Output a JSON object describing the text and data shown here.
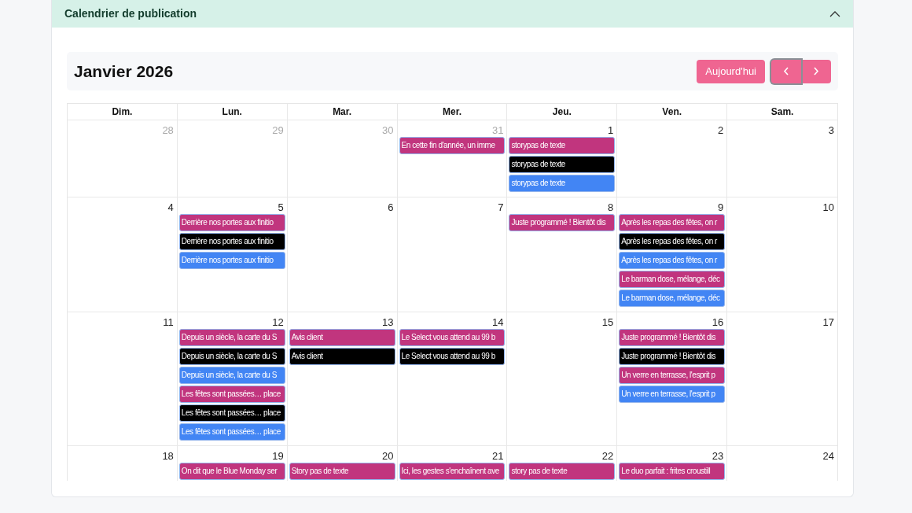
{
  "panel": {
    "title": "Calendrier de publication",
    "expanded": true
  },
  "toolbar": {
    "title": "Janvier 2026",
    "today_button": "Aujourd'hui"
  },
  "weekdays": [
    "Dim.",
    "Lun.",
    "Mar.",
    "Mer.",
    "Jeu.",
    "Ven.",
    "Sam."
  ],
  "weeks": [
    {
      "days": [
        {
          "number": "28",
          "other_month": true
        },
        {
          "number": "29",
          "other_month": true
        },
        {
          "number": "30",
          "other_month": true
        },
        {
          "number": "31",
          "other_month": true,
          "events": [
            {
              "title": "En cette fin d'année, un imme",
              "color": "#c1357e"
            }
          ]
        },
        {
          "number": "1",
          "other_month": false,
          "events": [
            {
              "title": "storypas de texte",
              "color": "#c1357e"
            },
            {
              "title": "storypas de texte",
              "color": "#000000"
            },
            {
              "title": "storypas de texte",
              "color": "#4285f4"
            }
          ]
        },
        {
          "number": "2",
          "other_month": false
        },
        {
          "number": "3",
          "other_month": false
        }
      ]
    },
    {
      "days": [
        {
          "number": "4",
          "other_month": false
        },
        {
          "number": "5",
          "other_month": false,
          "events": [
            {
              "title": "Derrière nos portes aux finitio",
              "color": "#c1357e"
            },
            {
              "title": "Derrière nos portes aux finitio",
              "color": "#000000"
            },
            {
              "title": "Derrière nos portes aux finitio",
              "color": "#4285f4"
            }
          ]
        },
        {
          "number": "6",
          "other_month": false
        },
        {
          "number": "7",
          "other_month": false
        },
        {
          "number": "8",
          "other_month": false,
          "events": [
            {
              "title": "Juste programmé ! Bientôt dis",
              "color": "#c1357e"
            }
          ]
        },
        {
          "number": "9",
          "other_month": false,
          "events": [
            {
              "title": "Après les repas des fêtes, on r",
              "color": "#c1357e"
            },
            {
              "title": "Après les repas des fêtes, on r",
              "color": "#000000"
            },
            {
              "title": "Après les repas des fêtes, on r",
              "color": "#4285f4"
            },
            {
              "title": "Le barman dose, mélange, déc",
              "color": "#c1357e"
            },
            {
              "title": "Le barman dose, mélange, déc",
              "color": "#4285f4"
            }
          ]
        },
        {
          "number": "10",
          "other_month": false
        }
      ]
    },
    {
      "days": [
        {
          "number": "11",
          "other_month": false
        },
        {
          "number": "12",
          "other_month": false,
          "events": [
            {
              "title": "Depuis un siècle, la carte du S",
              "color": "#c1357e"
            },
            {
              "title": "Depuis un siècle, la carte du S",
              "color": "#000000"
            },
            {
              "title": "Depuis un siècle, la carte du S",
              "color": "#4285f4"
            },
            {
              "title": "Les fêtes sont passées… place",
              "color": "#c1357e"
            },
            {
              "title": "Les fêtes sont passées… place",
              "color": "#000000"
            },
            {
              "title": "Les fêtes sont passées… place",
              "color": "#4285f4"
            }
          ]
        },
        {
          "number": "13",
          "other_month": false,
          "events": [
            {
              "title": "Avis client",
              "color": "#c1357e"
            },
            {
              "title": "Avis client",
              "color": "#000000"
            }
          ]
        },
        {
          "number": "14",
          "other_month": false,
          "events": [
            {
              "title": "Le Select vous attend au 99 b",
              "color": "#c1357e"
            },
            {
              "title": "Le Select vous attend au 99 b",
              "color": "#000000"
            }
          ]
        },
        {
          "number": "15",
          "other_month": false
        },
        {
          "number": "16",
          "other_month": false,
          "events": [
            {
              "title": "Juste programmé ! Bientôt dis",
              "color": "#c1357e"
            },
            {
              "title": "Juste programmé ! Bientôt dis",
              "color": "#000000"
            },
            {
              "title": "Un verre en terrasse, l'esprit p",
              "color": "#c1357e"
            },
            {
              "title": "Un verre en terrasse, l'esprit p",
              "color": "#4285f4"
            }
          ]
        },
        {
          "number": "17",
          "other_month": false
        }
      ]
    },
    {
      "days": [
        {
          "number": "18",
          "other_month": false
        },
        {
          "number": "19",
          "other_month": false,
          "events": [
            {
              "title": "On dit que le Blue Monday ser",
              "color": "#c1357e"
            }
          ]
        },
        {
          "number": "20",
          "other_month": false,
          "events": [
            {
              "title": "Story pas de texte",
              "color": "#c1357e"
            }
          ]
        },
        {
          "number": "21",
          "other_month": false,
          "events": [
            {
              "title": "Ici, les gestes s'enchaînent ave",
              "color": "#c1357e"
            }
          ]
        },
        {
          "number": "22",
          "other_month": false,
          "events": [
            {
              "title": "story pas de texte",
              "color": "#c1357e"
            }
          ]
        },
        {
          "number": "23",
          "other_month": false,
          "events": [
            {
              "title": "Le duo parfait : frites croustill",
              "color": "#c1357e"
            }
          ]
        },
        {
          "number": "24",
          "other_month": false
        }
      ]
    }
  ]
}
